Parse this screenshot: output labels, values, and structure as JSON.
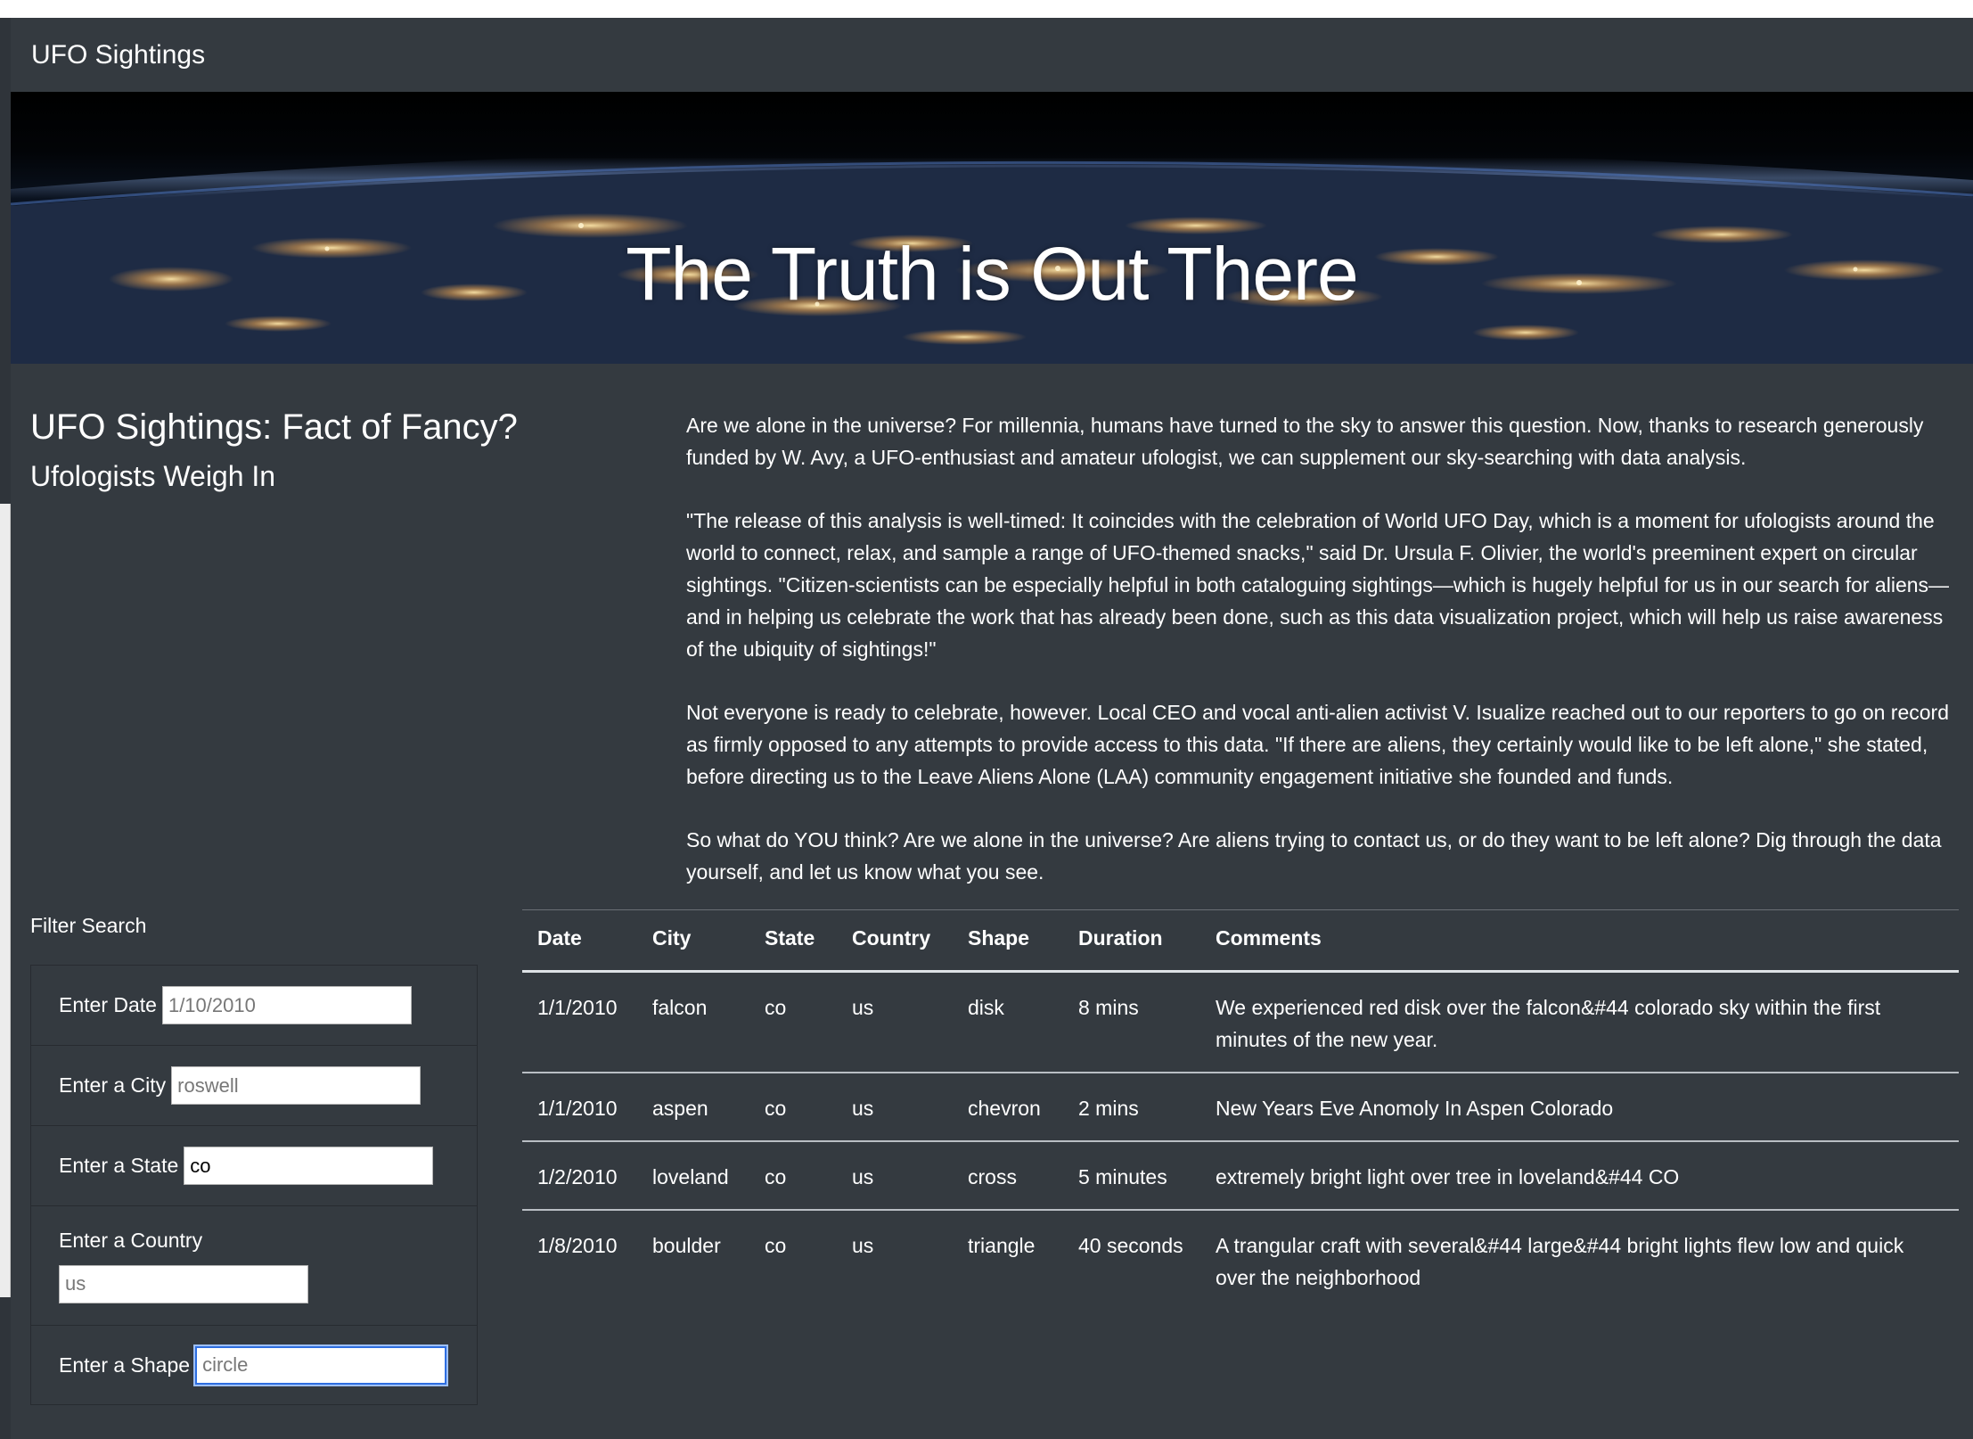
{
  "navbar": {
    "brand": "UFO Sightings"
  },
  "hero": {
    "title": "The Truth is Out There"
  },
  "intro": {
    "title": "UFO Sightings: Fact of Fancy?",
    "subtitle": "Ufologists Weigh In"
  },
  "article": {
    "paragraphs": [
      "Are we alone in the universe? For millennia, humans have turned to the sky to answer this question. Now, thanks to research generously funded by W. Avy, a UFO-enthusiast and amateur ufologist, we can supplement our sky-searching with data analysis.",
      "\"The release of this analysis is well-timed: It coincides with the celebration of World UFO Day, which is a moment for ufologists around the world to connect, relax, and sample a range of UFO-themed snacks,\" said Dr. Ursula F. Olivier, the world's preeminent expert on circular sightings. \"Citizen-scientists can be especially helpful in both cataloguing sightings—which is hugely helpful for us in our search for aliens—and in helping us celebrate the work that has already been done, such as this data visualization project, which will help us raise awareness of the ubiquity of sightings!\"",
      "Not everyone is ready to celebrate, however. Local CEO and vocal anti-alien activist V. Isualize reached out to our reporters to go on record as firmly opposed to any attempts to provide access to this data. \"If there are aliens, they certainly would like to be left alone,\" she stated, before directing us to the Leave Aliens Alone (LAA) community engagement initiative she founded and funds.",
      "So what do YOU think? Are we alone in the universe? Are aliens trying to contact us, or do they want to be left alone? Dig through the data yourself, and let us know what you see."
    ]
  },
  "filters": {
    "heading": "Filter Search",
    "date": {
      "label": "Enter Date",
      "placeholder": "1/10/2010",
      "value": ""
    },
    "city": {
      "label": "Enter a City",
      "placeholder": "roswell",
      "value": ""
    },
    "state": {
      "label": "Enter a State",
      "placeholder": "",
      "value": "co"
    },
    "country": {
      "label": "Enter a Country",
      "placeholder": "us",
      "value": ""
    },
    "shape": {
      "label": "Enter a Shape",
      "placeholder": "circle",
      "value": ""
    }
  },
  "table": {
    "headers": [
      "Date",
      "City",
      "State",
      "Country",
      "Shape",
      "Duration",
      "Comments"
    ],
    "rows": [
      [
        "1/1/2010",
        "falcon",
        "co",
        "us",
        "disk",
        "8 mins",
        "We experienced red disk over the falcon&#44 colorado sky within the first minutes of the new year."
      ],
      [
        "1/1/2010",
        "aspen",
        "co",
        "us",
        "chevron",
        "2 mins",
        "New Years Eve Anomoly In Aspen Colorado"
      ],
      [
        "1/2/2010",
        "loveland",
        "co",
        "us",
        "cross",
        "5 minutes",
        "extremely bright light over tree in loveland&#44 CO"
      ],
      [
        "1/8/2010",
        "boulder",
        "co",
        "us",
        "triangle",
        "40 seconds",
        "A trangular craft with several&#44 large&#44 bright lights flew low and quick over the neighborhood"
      ]
    ]
  },
  "colors": {
    "page_bg": "#343a40",
    "focus_ring": "#2e6ee0"
  }
}
